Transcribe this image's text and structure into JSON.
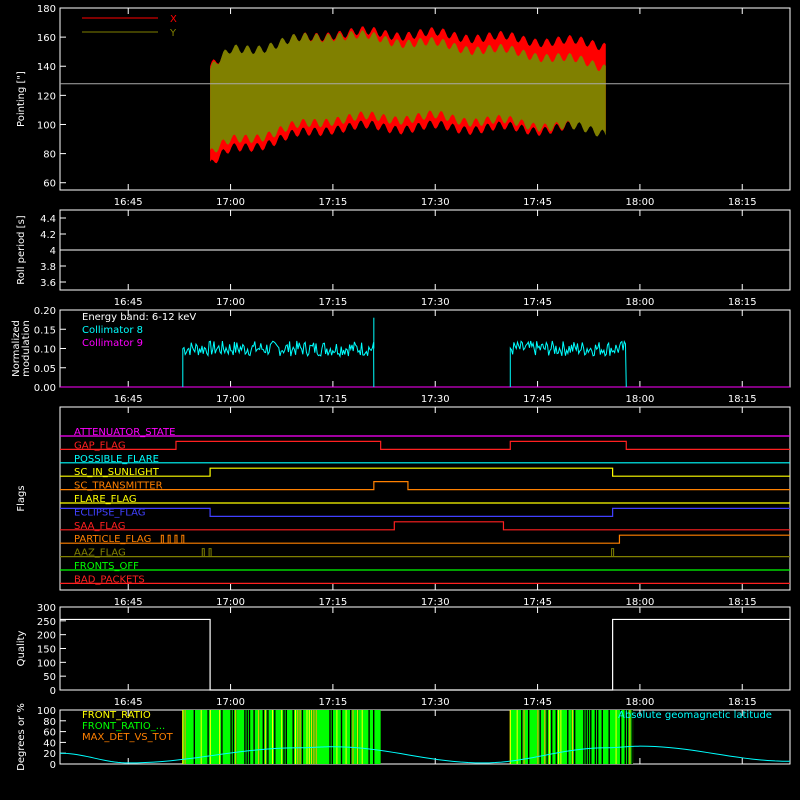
{
  "colors": {
    "x": "#ff0000",
    "y": "#808000",
    "cyan": "#00ffff",
    "magenta": "#ff00ff",
    "white": "#ffffff",
    "bg": "#000000"
  },
  "time_ticks": [
    "16:45",
    "17:00",
    "17:15",
    "17:30",
    "17:45",
    "18:00",
    "18:15"
  ],
  "chart_data": [
    {
      "id": "pointing",
      "type": "area",
      "ylabel": "Pointing [\"]",
      "ylim": [
        55,
        180
      ],
      "yticks": [
        60,
        80,
        100,
        120,
        140,
        160,
        180
      ],
      "x_range": [
        "16:35",
        "18:22"
      ],
      "data_range": [
        "16:57",
        "17:55"
      ],
      "reference_line": 128,
      "legend_placement": "top-left",
      "series": [
        {
          "name": "X",
          "color": "#ff0000",
          "upper": [
            [
              16.95,
              140
            ],
            [
              17.0,
              148
            ],
            [
              17.25,
              163
            ],
            [
              17.5,
              162
            ],
            [
              17.75,
              158
            ],
            [
              17.92,
              155
            ]
          ],
          "lower": [
            [
              16.95,
              72
            ],
            [
              17.0,
              82
            ],
            [
              17.25,
              98
            ],
            [
              17.5,
              98
            ],
            [
              17.75,
              97
            ],
            [
              17.92,
              98
            ]
          ]
        },
        {
          "name": "Y",
          "color": "#808000",
          "upper": [
            [
              16.95,
              138
            ],
            [
              17.0,
              150
            ],
            [
              17.25,
              162
            ],
            [
              17.5,
              155
            ],
            [
              17.75,
              148
            ],
            [
              17.92,
              140
            ]
          ],
          "lower": [
            [
              16.95,
              80
            ],
            [
              17.0,
              88
            ],
            [
              17.25,
              104
            ],
            [
              17.5,
              105
            ],
            [
              17.75,
              100
            ],
            [
              17.92,
              95
            ]
          ]
        }
      ]
    },
    {
      "id": "roll",
      "type": "line",
      "ylabel": "Roll period [s]",
      "ylim": [
        3.5,
        4.5
      ],
      "yticks": [
        3.6,
        3.8,
        4.0,
        4.2,
        4.4
      ],
      "series": [
        {
          "name": "",
          "x": [
            "16:35",
            "18:22"
          ],
          "values": [
            4.0,
            4.0
          ]
        }
      ]
    },
    {
      "id": "modulation",
      "type": "line",
      "ylabel": "Normalized modulation",
      "ylim": [
        0,
        0.2
      ],
      "yticks": [
        "0.00",
        "0.05",
        "0.10",
        "0.15",
        "0.20"
      ],
      "annotation": "Energy band: 6-12 keV",
      "series": [
        {
          "name": "Collimator 8",
          "color": "#00ffff",
          "segments": [
            [
              "16:53",
              "17:21",
              0.1
            ],
            [
              "17:41",
              "17:58",
              0.1
            ]
          ],
          "spikes": [
            [
              "17:21",
              0.18
            ]
          ]
        },
        {
          "name": "Collimator 9",
          "color": "#ff00ff",
          "values": [
            0
          ]
        }
      ]
    },
    {
      "id": "flags",
      "type": "line",
      "ylabel": "Flags",
      "rows": [
        {
          "label": "ATTENUATOR_STATE",
          "color": "#ff00ff",
          "steps": []
        },
        {
          "label": "GAP_FLAG",
          "color": "#ff2020",
          "steps": [
            [
              "16:35",
              0
            ],
            [
              "16:52",
              1
            ],
            [
              "17:22",
              0
            ],
            [
              "17:41",
              1
            ],
            [
              "17:58",
              0
            ]
          ]
        },
        {
          "label": "POSSIBLE_FLARE",
          "color": "#00ffff",
          "steps": []
        },
        {
          "label": "SC_IN_SUNLIGHT",
          "color": "#ffff00",
          "steps": [
            [
              "16:35",
              0
            ],
            [
              "16:57",
              1
            ],
            [
              "17:56",
              0
            ]
          ]
        },
        {
          "label": "SC_TRANSMITTER",
          "color": "#ff8000",
          "steps": [
            [
              "16:35",
              0
            ],
            [
              "17:21",
              1
            ],
            [
              "17:26",
              0
            ]
          ]
        },
        {
          "label": "FLARE_FLAG",
          "color": "#ffff00",
          "steps": []
        },
        {
          "label": "ECLIPSE_FLAG",
          "color": "#4040ff",
          "steps": [
            [
              "16:35",
              1
            ],
            [
              "16:57",
              0
            ],
            [
              "17:56",
              1
            ]
          ]
        },
        {
          "label": "SAA_FLAG",
          "color": "#ff2020",
          "steps": [
            [
              "16:35",
              0
            ],
            [
              "17:24",
              1
            ],
            [
              "17:40",
              0
            ]
          ]
        },
        {
          "label": "PARTICLE_FLAG",
          "color": "#ff8000",
          "steps": [
            [
              "16:35",
              0
            ],
            [
              "17:57",
              1
            ]
          ],
          "pulses": [
            "16:50",
            "16:51",
            "16:52",
            "16:53"
          ]
        },
        {
          "label": "AAZ_FLAG",
          "color": "#808000",
          "steps": [],
          "pulses": [
            "16:56",
            "16:57",
            "17:56"
          ]
        },
        {
          "label": "FRONTS_OFF",
          "color": "#00ff00",
          "steps": []
        },
        {
          "label": "BAD_PACKETS",
          "color": "#ff2020",
          "steps": []
        }
      ]
    },
    {
      "id": "quality",
      "type": "line",
      "ylabel": "Quality",
      "ylim": [
        0,
        300
      ],
      "yticks": [
        0,
        50,
        100,
        150,
        200,
        250,
        300
      ],
      "series": [
        {
          "name": "",
          "steps": [
            [
              "16:35",
              255
            ],
            [
              "16:57",
              0
            ],
            [
              "17:56",
              255
            ]
          ]
        }
      ]
    },
    {
      "id": "degrees",
      "type": "line",
      "ylabel": "Degrees or %",
      "ylim": [
        0,
        100
      ],
      "yticks": [
        0,
        20,
        40,
        60,
        80,
        100
      ],
      "legend_placement": "top-left",
      "series": [
        {
          "name": "FRONT_RATIO",
          "color": "#ffff00"
        },
        {
          "name": "FRONT_RATIO_...",
          "color": "#00ff00",
          "filled_intervals": [
            [
              "16:53",
              "17:22"
            ],
            [
              "17:41",
              "17:59"
            ]
          ]
        },
        {
          "name": "MAX_DET_VS_TOT",
          "color": "#ff8000"
        },
        {
          "name": "Absolute geomagnetic latitude",
          "color": "#00ffff",
          "curve": [
            [
              "16:35",
              20
            ],
            [
              "16:45",
              2
            ],
            [
              "17:10",
              30
            ],
            [
              "17:15",
              32
            ],
            [
              "17:37",
              2
            ],
            [
              "17:55",
              30
            ],
            [
              "18:00",
              33
            ],
            [
              "18:22",
              5
            ]
          ]
        }
      ]
    }
  ]
}
